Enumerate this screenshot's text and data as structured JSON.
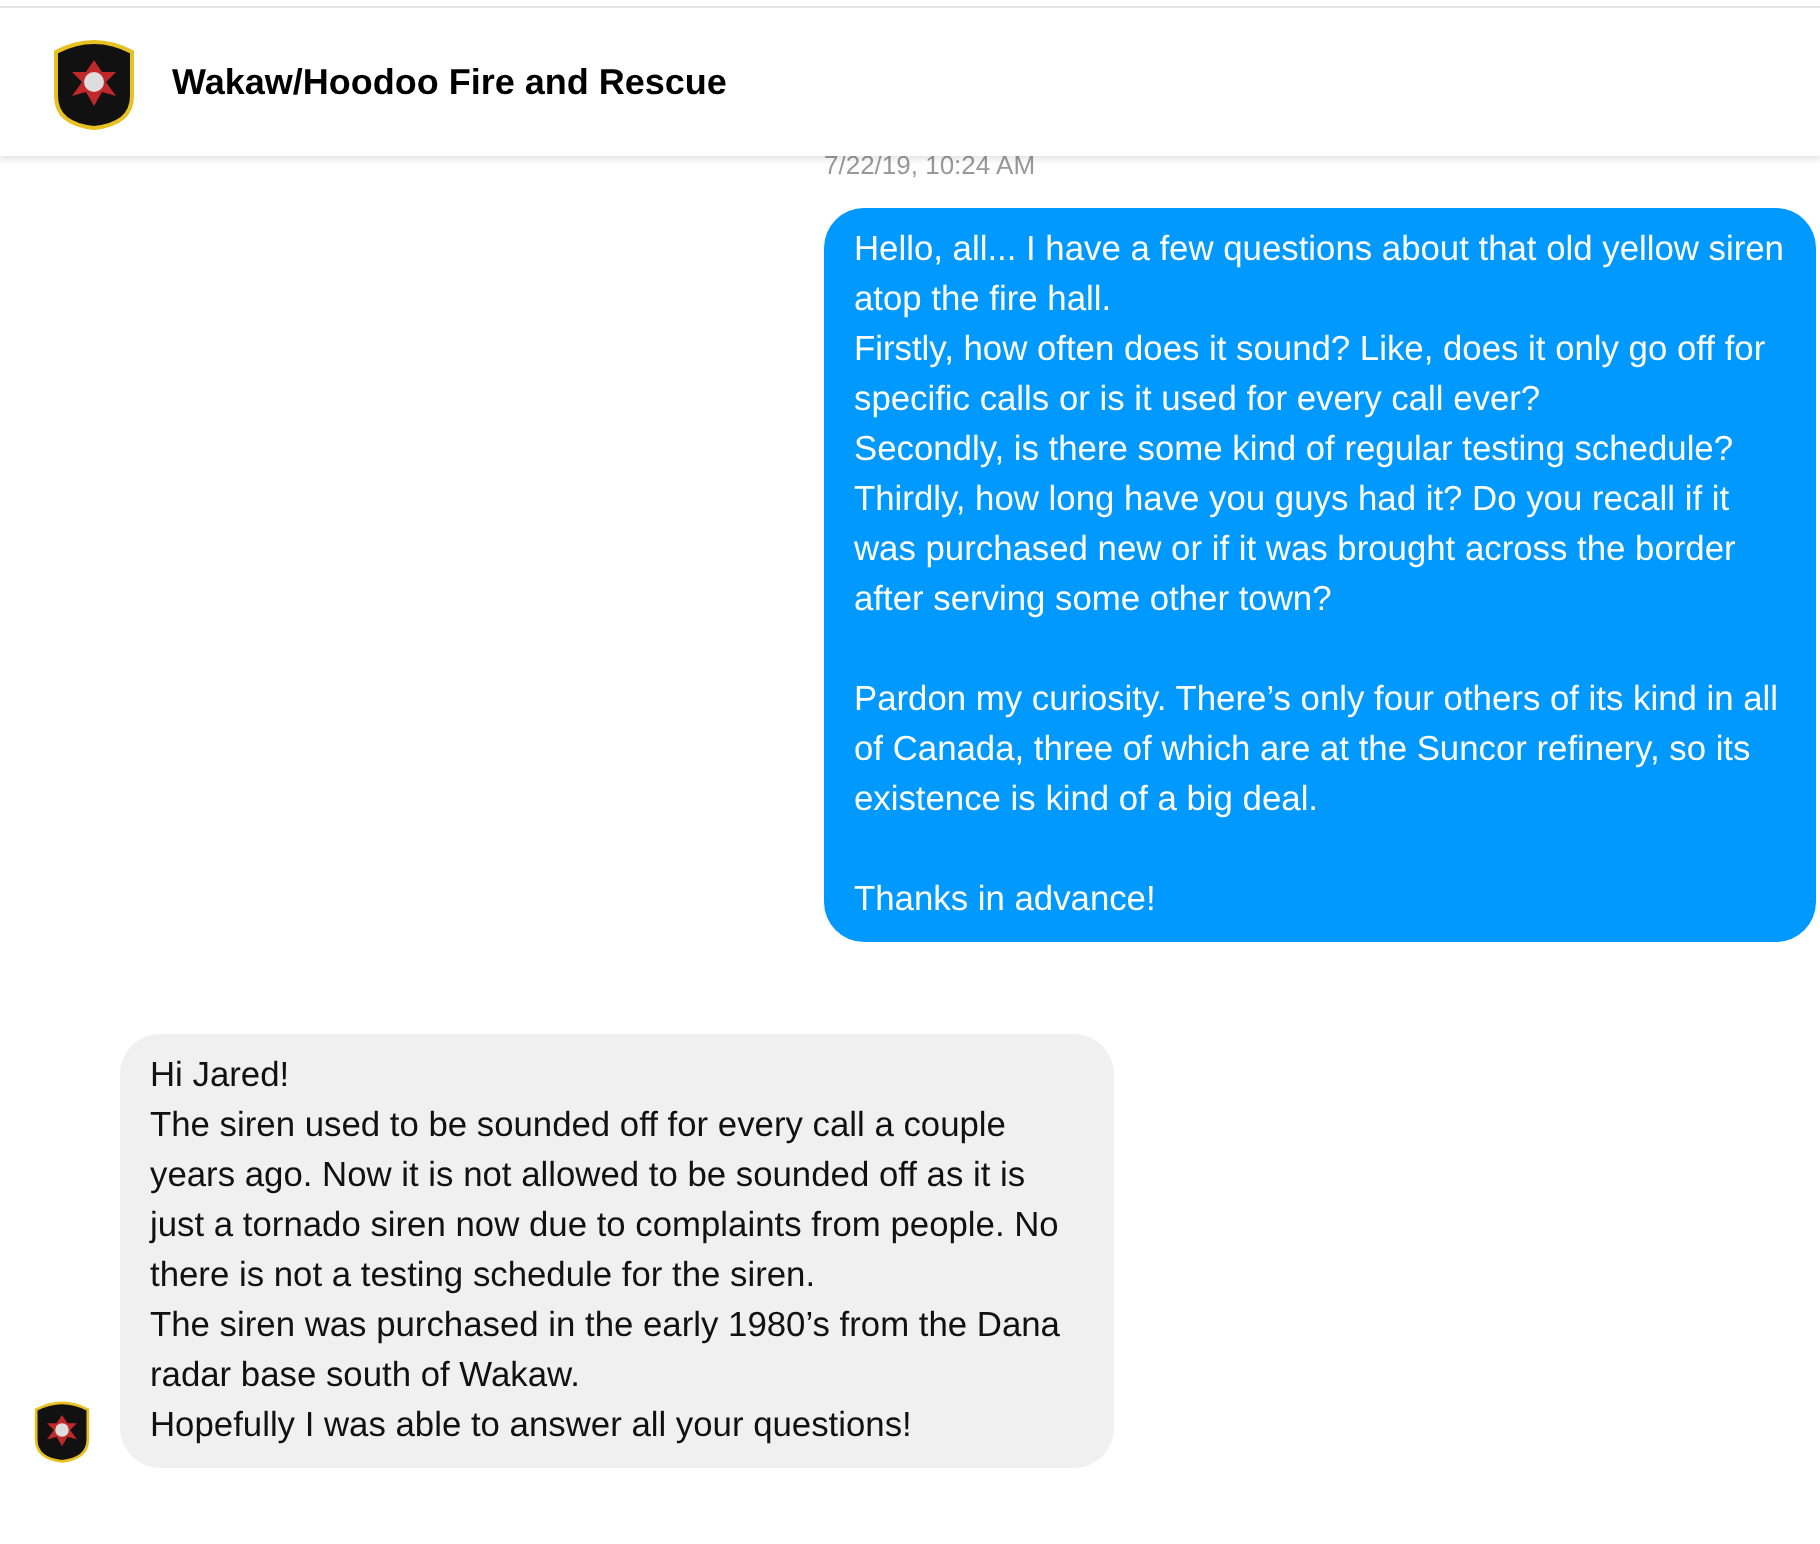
{
  "header": {
    "title": "Wakaw/Hoodoo Fire and Rescue"
  },
  "timestamp": "7/22/19, 10:24 AM",
  "messages": [
    {
      "kind": "outgoing",
      "text": "Hello, all... I have a few questions about that old yellow siren atop the fire hall.\nFirstly, how often does it sound? Like, does it only go off for specific calls or is it used for every call ever?\nSecondly, is there some kind of regular testing schedule?\nThirdly, how long have you guys had it? Do you recall if it was purchased new or if it was brought across the border after serving some other town?\n\nPardon my curiosity. There’s only four others of its kind in all of Canada, three of which are at the Suncor refinery, so its existence is kind of a big deal.\n\nThanks in advance!"
    },
    {
      "kind": "incoming",
      "text": "Hi Jared!\nThe siren used to be sounded off for every call a couple years ago. Now it is not allowed to be sounded off as it is just a tornado siren now due to complaints from people. No there is not a testing schedule for the siren.\nThe siren was purchased in the early 1980’s from the Dana radar base south of Wakaw.\nHopefully I was able to answer all your questions!"
    }
  ]
}
